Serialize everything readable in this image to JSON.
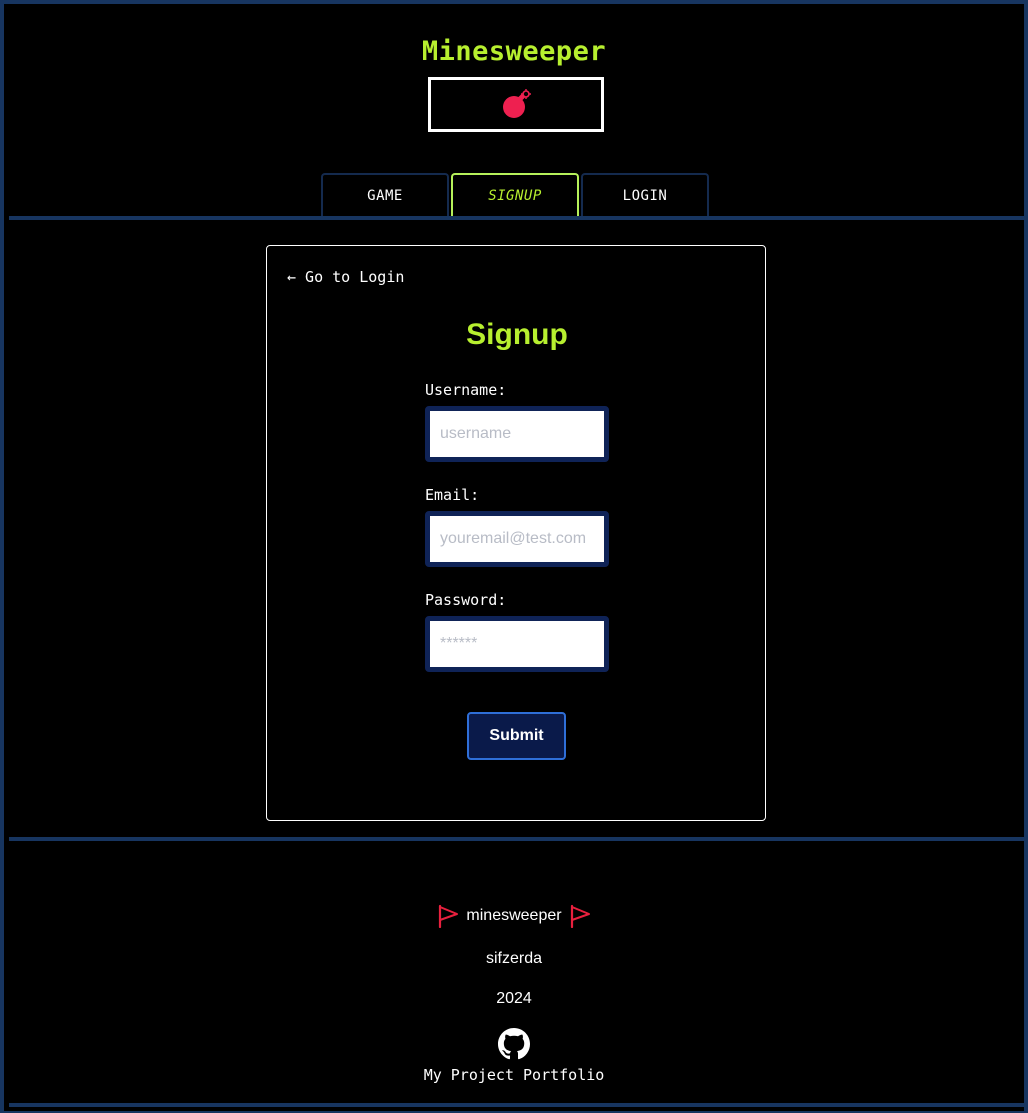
{
  "header": {
    "title": "Minesweeper",
    "logo_icon": "bomb-icon",
    "accent_color": "#b7ef2f"
  },
  "tabs": [
    {
      "label": "GAME",
      "active": false
    },
    {
      "label": "SIGNUP",
      "active": true
    },
    {
      "label": "LOGIN",
      "active": false
    }
  ],
  "form": {
    "back_link": "← Go to Login",
    "title": "Signup",
    "fields": [
      {
        "label": "Username:",
        "placeholder": "username",
        "value": ""
      },
      {
        "label": "Email:",
        "placeholder": "youremail@test.com",
        "value": ""
      },
      {
        "label": "Password:",
        "placeholder": "******",
        "value": ""
      }
    ],
    "submit_label": "Submit"
  },
  "footer": {
    "brand": "minesweeper",
    "brand_icon": "flag-icon",
    "author": "sifzerda",
    "year": "2024",
    "github_icon": "github-icon",
    "portfolio_link": "My Project Portfolio"
  }
}
